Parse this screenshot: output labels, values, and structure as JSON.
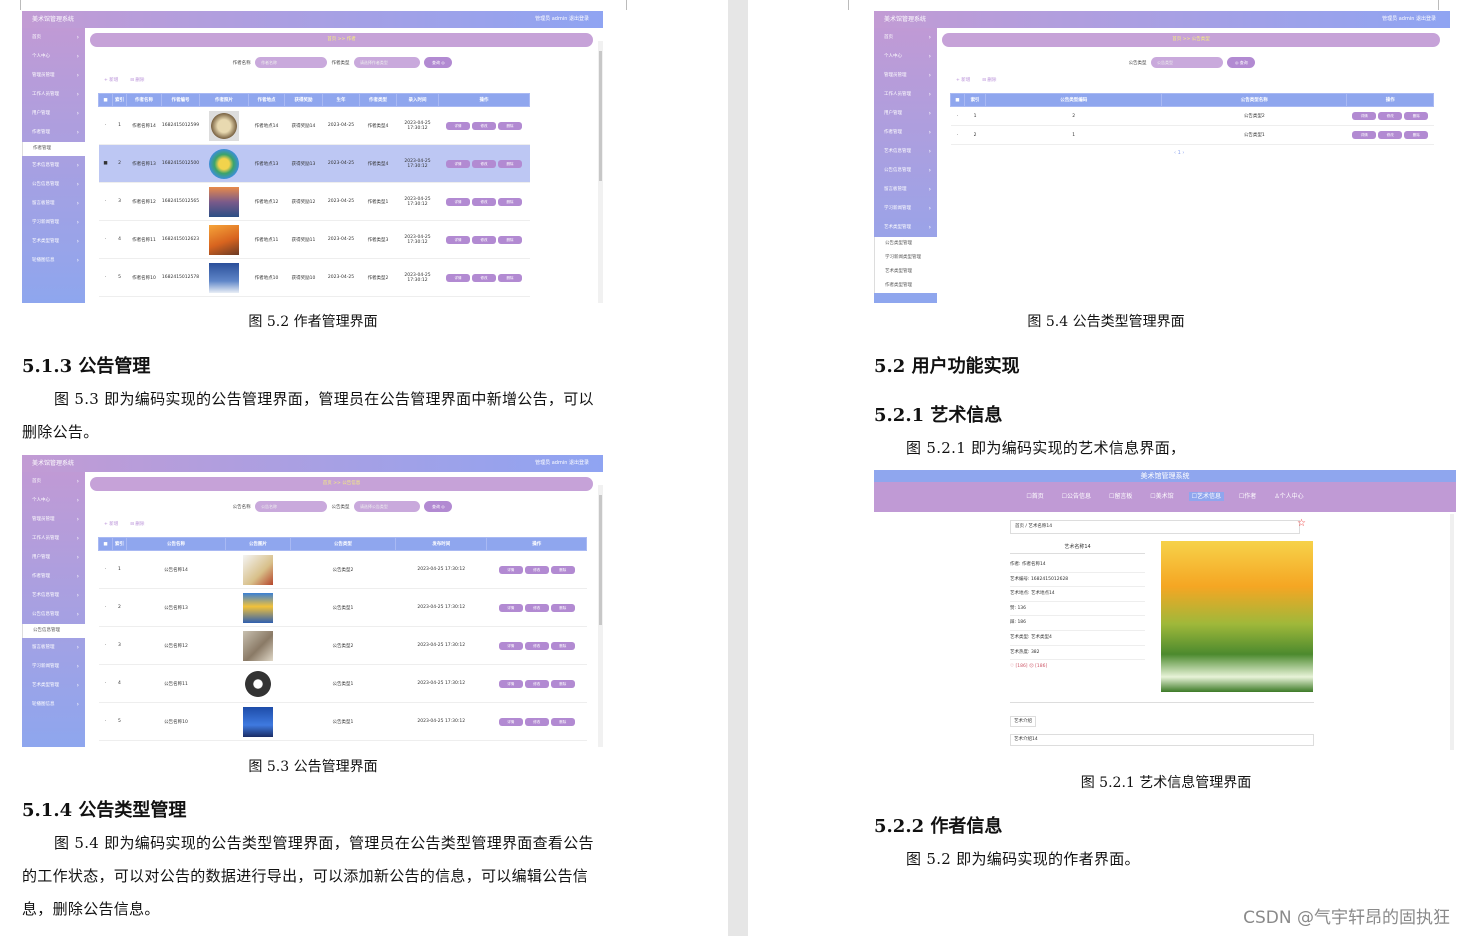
{
  "left": {
    "fig52_caption": "图 5.2  作者管理界面",
    "sec513_title": "5.1.3  公告管理",
    "sec513_body": "图 5.3  即为编码实现的公告管理界面，管理员在公告管理界面中新增公告，可以删除公告。",
    "fig53_caption": "图 5.3  公告管理界面",
    "sec514_title": "5.1.4  公告类型管理",
    "sec514_body": "图 5.4  即为编码实现的公告类型管理界面，管理员在公告类型管理界面查看公告的工作状态，可以对公告的数据进行导出，可以添加新公告的信息，可以编辑公告信息，删除公告信息。"
  },
  "right": {
    "fig54_caption": "图 5.4  公告类型管理界面",
    "sec52_title": "5.2  用户功能实现",
    "sec521_title": "5.2.1  艺术信息",
    "sec521_body": "图 5.2.1  即为编码实现的艺术信息界面，",
    "fig521_caption": "图 5.2.1  艺术信息管理界面",
    "sec522_title": "5.2.2  作者信息",
    "sec522_body": "图 5.2  即为编码实现的作者界面。",
    "watermark": "CSDN @气宇轩昂的固执狂"
  },
  "admin": {
    "app_title": "美术馆管理系统",
    "top_right": "管理员 admin    退出登录",
    "menu": [
      "首页",
      "个人中心",
      "管理员管理",
      "工作人员管理",
      "用户管理",
      "作者管理",
      "艺术信息管理",
      "公告信息管理",
      "留言板管理",
      "学习新闻管理",
      "艺术类型管理",
      "轮播图信息"
    ],
    "add": "+ 新增",
    "delete": "⊟ 删除",
    "search_btn": "查询 ◎",
    "op_detail": "详情",
    "op_edit": "修改",
    "op_del": "删除"
  },
  "fig52": {
    "crumb": "首页  >>  作者",
    "submenu": "作者管理",
    "search_l1": "作者名称",
    "search_l2": "作者类型",
    "ph1": "作者名称",
    "ph2": "请选择作者类型",
    "headers": [
      "索引",
      "作者名称",
      "作者编号",
      "作者照片",
      "作者地点",
      "获得奖励",
      "生年",
      "作者类型",
      "录入时间",
      "操作"
    ],
    "rows": [
      [
        "1",
        "作者名称14",
        "1682415012599",
        "作者地点14",
        "获得奖励14",
        "2023-04-25",
        "作者类型4",
        "2023-04-25 17:30:12"
      ],
      [
        "2",
        "作者名称13",
        "1682415012500",
        "作者地点13",
        "获得奖励13",
        "2023-04-25",
        "作者类型4",
        "2023-04-25 17:30:12"
      ],
      [
        "3",
        "作者名称12",
        "1682415012565",
        "作者地点12",
        "获得奖励12",
        "2023-04-25",
        "作者类型1",
        "2023-04-25 17:30:12"
      ],
      [
        "4",
        "作者名称11",
        "1682415012623",
        "作者地点11",
        "获得奖励11",
        "2023-04-25",
        "作者类型3",
        "2023-04-25 17:30:12"
      ],
      [
        "5",
        "作者名称10",
        "1682415012578",
        "作者地点10",
        "获得奖励10",
        "2023-04-25",
        "作者类型2",
        "2023-04-25 17:30:12"
      ]
    ]
  },
  "fig53": {
    "crumb": "首页  >>  公告信息",
    "submenu": "公告信息管理",
    "search_l1": "公告名称",
    "search_l2": "公告类型",
    "ph1": "公告名称",
    "ph2": "请选择公告类型",
    "headers": [
      "索引",
      "公告名称",
      "公告图片",
      "公告类型",
      "发布时间",
      "操作"
    ],
    "rows": [
      [
        "1",
        "公告名称14",
        "公告类型2",
        "2023-04-25 17:30:12"
      ],
      [
        "2",
        "公告名称13",
        "公告类型1",
        "2023-04-25 17:30:12"
      ],
      [
        "3",
        "公告名称12",
        "公告类型2",
        "2023-04-25 17:30:12"
      ],
      [
        "4",
        "公告名称11",
        "公告类型1",
        "2023-04-25 17:30:12"
      ],
      [
        "5",
        "公告名称10",
        "公告类型1",
        "2023-04-25 17:30:12"
      ]
    ]
  },
  "fig54": {
    "crumb": "首页  >>  公告类型",
    "search_l1": "公告类型",
    "ph1": "公告类型",
    "search_btn": "◎ 查询",
    "headers": [
      "索引",
      "公告类型编码",
      "公告类型名称",
      "操作"
    ],
    "rows": [
      [
        "1",
        "2",
        "公告类型2"
      ],
      [
        "2",
        "1",
        "公告类型1"
      ]
    ],
    "pager": "‹  1  ›",
    "submenus": [
      "公告类型管理",
      "学习新闻类型管理",
      "艺术类型管理",
      "作者类型管理"
    ]
  },
  "fig521": {
    "site_title": "美术馆管理系统",
    "nav": [
      "☐首页",
      "☐公告信息",
      "☐留言板",
      "☐美术馆",
      "☐艺术信息",
      "☐作者",
      "♙个人中心"
    ],
    "crumb": "首页 / 艺术名称14",
    "name": "艺术名称14",
    "fields": [
      "作者: 作者名称14",
      "艺术编号: 1682415012628",
      "艺术地点: 艺术地点14",
      "赞: 136",
      "踩: 186",
      "艺术类型: 艺术类型4",
      "艺术热度: 382",
      "♡ [186] ☹ [186]"
    ],
    "tab": "艺术介绍",
    "intro": "艺术介绍14"
  }
}
